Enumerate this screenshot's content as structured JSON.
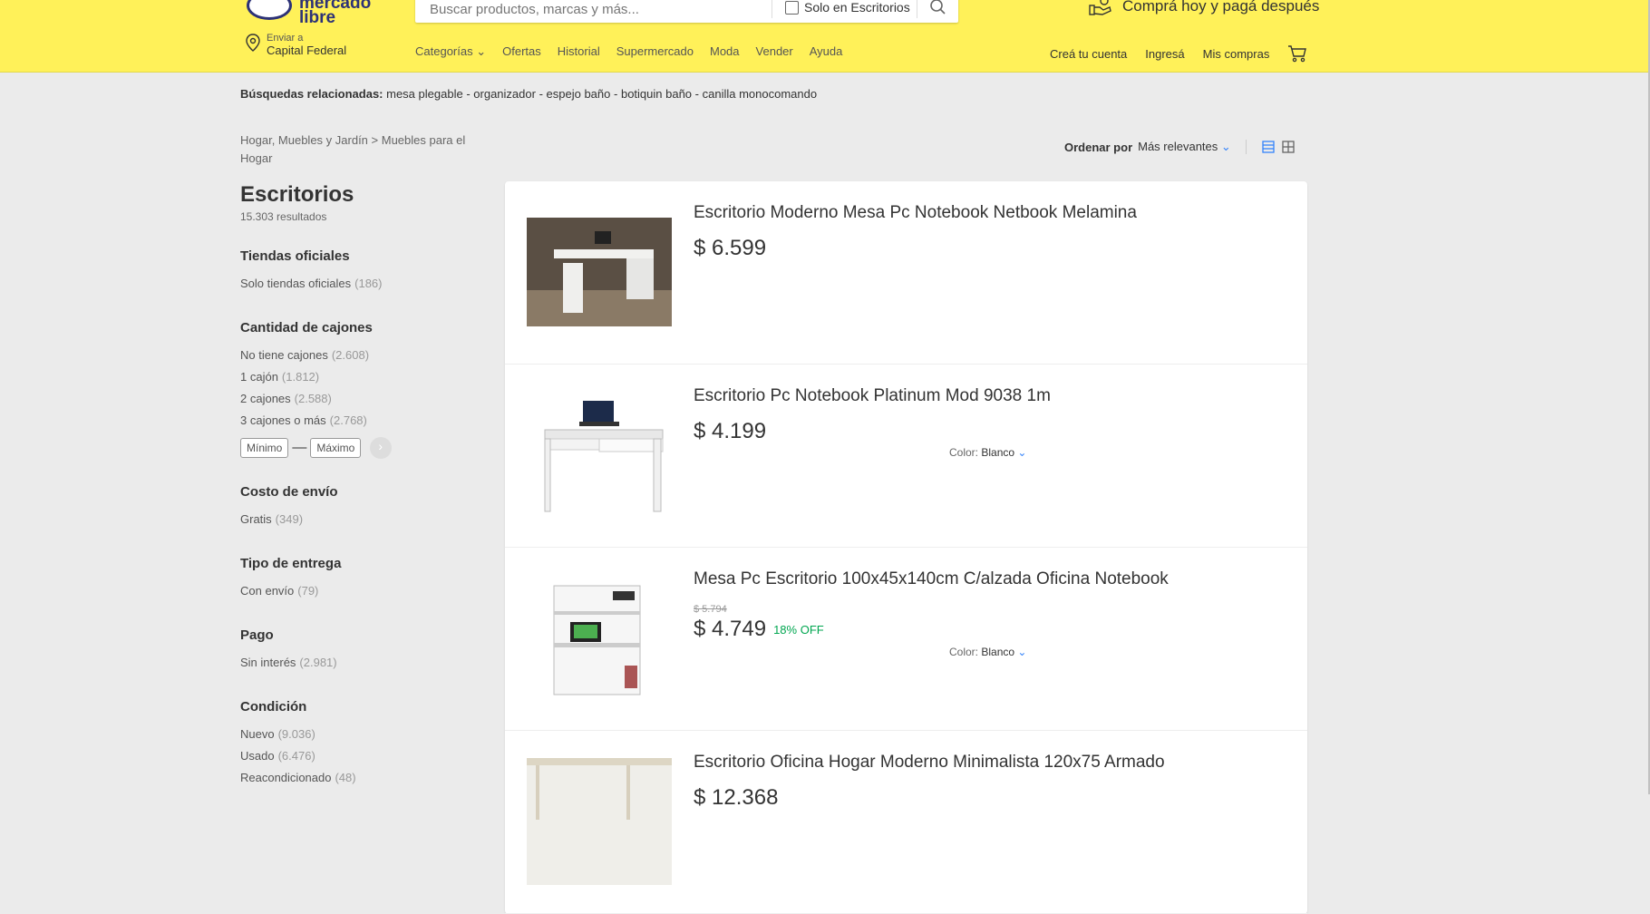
{
  "header": {
    "logo_text_1": "mercado",
    "logo_text_2": "libre",
    "search_placeholder": "Buscar productos, marcas y más...",
    "only_in_label": "Solo en Escritorios",
    "promo_text": "Comprá hoy y pagá después",
    "location_line1": "Enviar a",
    "location_line2": "Capital Federal",
    "nav": [
      "Categorías",
      "Ofertas",
      "Historial",
      "Supermercado",
      "Moda",
      "Vender",
      "Ayuda"
    ],
    "account": [
      "Creá tu cuenta",
      "Ingresá",
      "Mis compras"
    ],
    "accent_color": "#fff159"
  },
  "related": {
    "label": "Búsquedas relacionadas:",
    "items": [
      "mesa plegable",
      "organizador",
      "espejo baño",
      "botiquin baño",
      "canilla monocomando"
    ],
    "separator": "-"
  },
  "breadcrumb": {
    "parts": [
      "Hogar, Muebles y Jardín",
      "Muebles para el Hogar"
    ],
    "separator": ">"
  },
  "sort": {
    "label": "Ordenar por",
    "value": "Más relevantes"
  },
  "sidebar": {
    "title": "Escritorios",
    "count": "15.303 resultados",
    "groups": [
      {
        "title": "Tiendas oficiales",
        "items": [
          {
            "label": "Solo tiendas oficiales",
            "count": "(186)"
          }
        ]
      },
      {
        "title": "Cantidad de cajones",
        "items": [
          {
            "label": "No tiene cajones",
            "count": "(2.608)"
          },
          {
            "label": "1 cajón",
            "count": "(1.812)"
          },
          {
            "label": "2 cajones",
            "count": "(2.588)"
          },
          {
            "label": "3 cajones o más",
            "count": "(2.768)"
          }
        ],
        "range": {
          "min": "Mínimo",
          "max": "Máximo",
          "dash": "—"
        }
      },
      {
        "title": "Costo de envío",
        "items": [
          {
            "label": "Gratis",
            "count": "(349)"
          }
        ]
      },
      {
        "title": "Tipo de entrega",
        "items": [
          {
            "label": "Con envío",
            "count": "(79)"
          }
        ]
      },
      {
        "title": "Pago",
        "items": [
          {
            "label": "Sin interés",
            "count": "(2.981)"
          }
        ]
      },
      {
        "title": "Condición",
        "items": [
          {
            "label": "Nuevo",
            "count": "(9.036)"
          },
          {
            "label": "Usado",
            "count": "(6.476)"
          },
          {
            "label": "Reacondicionado",
            "count": "(48)"
          }
        ]
      }
    ]
  },
  "products": [
    {
      "title": "Escritorio Moderno Mesa Pc Notebook Netbook Melamina",
      "price": "$ 6.599",
      "old_price": "",
      "discount": "",
      "color_label": "",
      "color_value": ""
    },
    {
      "title": "Escritorio Pc Notebook Platinum Mod 9038 1m",
      "price": "$ 4.199",
      "old_price": "",
      "discount": "",
      "color_label": "Color:",
      "color_value": "Blanco"
    },
    {
      "title": "Mesa Pc Escritorio 100x45x140cm C/alzada Oficina Notebook",
      "price": "$ 4.749",
      "old_price": "$ 5.794",
      "discount": "18% OFF",
      "color_label": "Color:",
      "color_value": "Blanco"
    },
    {
      "title": "Escritorio Oficina Hogar Moderno Minimalista 120x75 Armado",
      "price": "$ 12.368",
      "old_price": "",
      "discount": "",
      "color_label": "",
      "color_value": ""
    }
  ]
}
